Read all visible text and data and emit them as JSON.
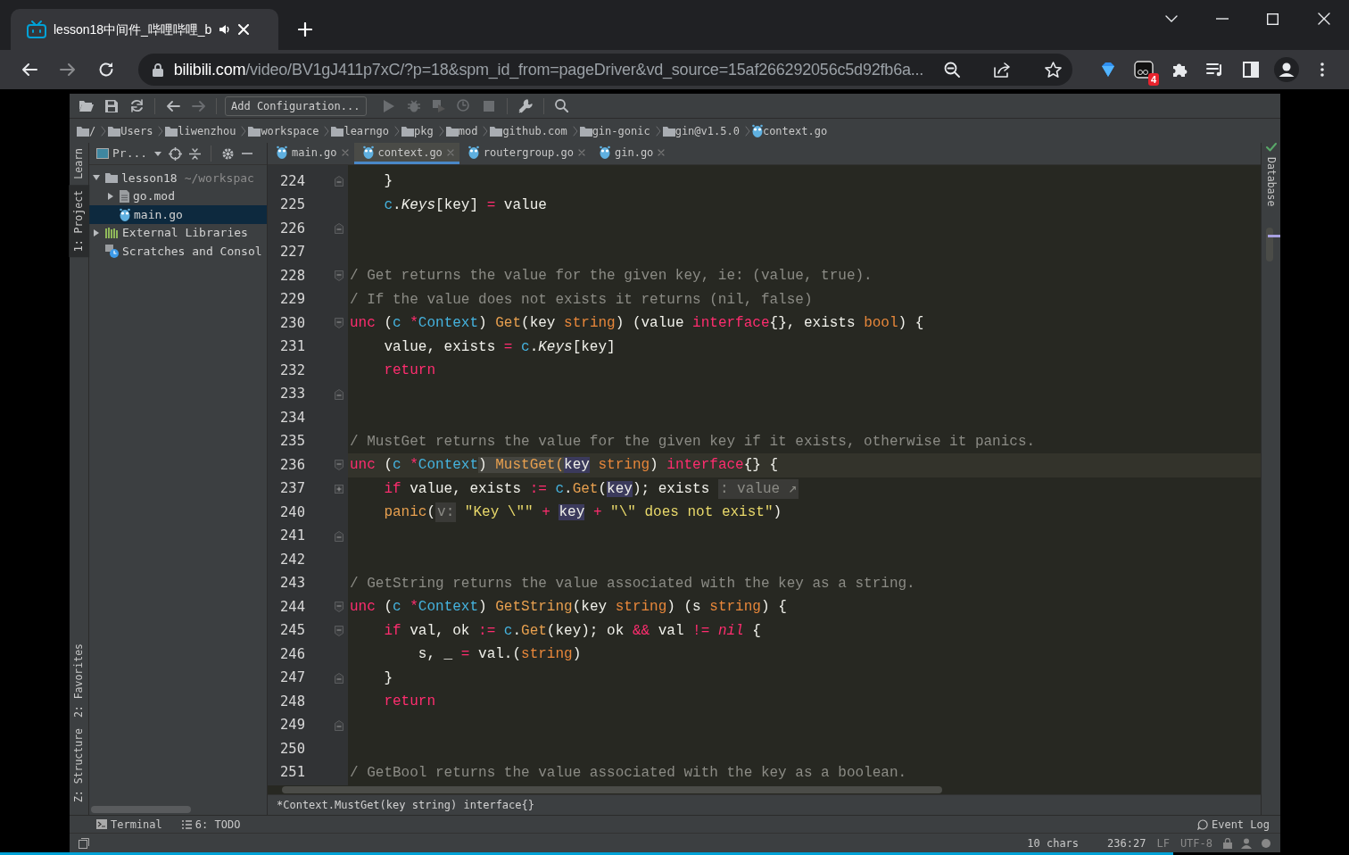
{
  "browser": {
    "tab": {
      "title": "lesson18中间件_哔哩哔哩_b",
      "selected": true
    },
    "address": {
      "host": "bilibili.com",
      "path": "/video/BV1gJ411p7xC/?p=18&spm_id_from=pageDriver&vd_source=15af266292056c5d92fb6a..."
    },
    "extension_badge": "4"
  },
  "ide": {
    "toolbar": {
      "run_config": "Add Configuration..."
    },
    "breadcrumbs": [
      {
        "label": "/",
        "kind": "folder"
      },
      {
        "label": "Users",
        "kind": "folder"
      },
      {
        "label": "liwenzhou",
        "kind": "folder"
      },
      {
        "label": "workspace",
        "kind": "folder"
      },
      {
        "label": "learngo",
        "kind": "folder"
      },
      {
        "label": "pkg",
        "kind": "folder"
      },
      {
        "label": "mod",
        "kind": "folder"
      },
      {
        "label": "github.com",
        "kind": "folder"
      },
      {
        "label": "gin-gonic",
        "kind": "folder"
      },
      {
        "label": "gin@v1.5.0",
        "kind": "folder"
      },
      {
        "label": "context.go",
        "kind": "go"
      }
    ],
    "left_strip": {
      "top": [
        {
          "label": "Learn",
          "selected": false
        },
        {
          "label": "1: Project",
          "selected": true
        }
      ],
      "bottom": [
        {
          "label": "2: Favorites",
          "selected": false
        },
        {
          "label": "Z: Structure",
          "selected": false
        }
      ]
    },
    "project_panel": {
      "title": "Pr...",
      "tree": [
        {
          "label": "lesson18",
          "note": "~/workspac",
          "kind": "folder",
          "expanded": true,
          "selected": false,
          "children": [
            {
              "label": "go.mod",
              "kind": "mod",
              "expanded": false,
              "selected": false
            },
            {
              "label": "main.go",
              "kind": "go",
              "selected": true
            }
          ]
        },
        {
          "label": "External Libraries",
          "kind": "library",
          "expanded": false,
          "selected": false
        },
        {
          "label": "Scratches and Consol",
          "kind": "scratch",
          "selected": false
        }
      ]
    },
    "tabs": [
      {
        "label": "main.go",
        "selected": false
      },
      {
        "label": "context.go",
        "selected": true
      },
      {
        "label": "routergroup.go",
        "selected": false
      },
      {
        "label": "gin.go",
        "selected": false
      }
    ],
    "editor": {
      "lines": [
        {
          "number": "224",
          "current": false,
          "kind": "fold-end",
          "tokens": [
            {
              "kind": "plain",
              "text": "    }"
            }
          ]
        },
        {
          "number": "225",
          "current": false,
          "kind": "plain",
          "tokens": [
            {
              "kind": "recv",
              "text": "    c"
            },
            {
              "kind": "plain",
              "text": "."
            },
            {
              "kind": "field",
              "text": "Keys"
            },
            {
              "kind": "plain",
              "text": "[key] "
            },
            {
              "kind": "op",
              "text": "="
            },
            {
              "kind": "plain",
              "text": " value"
            }
          ]
        },
        {
          "number": "226",
          "current": false,
          "kind": "fold-end"
        },
        {
          "number": "227",
          "current": false,
          "kind": "plain"
        },
        {
          "number": "228",
          "current": false,
          "kind": "fold-start",
          "tokens": [
            {
              "kind": "cmt",
              "text": "/ Get returns the value for the given key, ie: (value, true)."
            }
          ]
        },
        {
          "number": "229",
          "current": false,
          "kind": "plain",
          "tokens": [
            {
              "kind": "cmt",
              "text": "/ If the value does not exists it returns (nil, false)"
            }
          ]
        },
        {
          "number": "230",
          "current": false,
          "kind": "fold-start",
          "tokens": [
            {
              "kind": "kw",
              "text": "unc"
            },
            {
              "kind": "plain",
              "text": " ("
            },
            {
              "kind": "recv",
              "text": "c"
            },
            {
              "kind": "op",
              "text": " *"
            },
            {
              "kind": "recv",
              "text": "Context"
            },
            {
              "kind": "plain",
              "text": ") "
            },
            {
              "kind": "fn",
              "text": "Get"
            },
            {
              "kind": "plain",
              "text": "(key "
            },
            {
              "kind": "type",
              "text": "string"
            },
            {
              "kind": "plain",
              "text": ") (value "
            },
            {
              "kind": "kw",
              "text": "interface"
            },
            {
              "kind": "plain",
              "text": "{}, exists "
            },
            {
              "kind": "type",
              "text": "bool"
            },
            {
              "kind": "plain",
              "text": ") {"
            }
          ]
        },
        {
          "number": "231",
          "current": false,
          "kind": "plain",
          "tokens": [
            {
              "kind": "plain",
              "text": "    value, exists "
            },
            {
              "kind": "op",
              "text": "="
            },
            {
              "kind": "recv",
              "text": " c"
            },
            {
              "kind": "plain",
              "text": "."
            },
            {
              "kind": "field",
              "text": "Keys"
            },
            {
              "kind": "plain",
              "text": "[key]"
            }
          ]
        },
        {
          "number": "232",
          "current": false,
          "kind": "plain",
          "tokens": [
            {
              "kind": "kw",
              "text": "    return"
            }
          ]
        },
        {
          "number": "233",
          "current": false,
          "kind": "fold-end"
        },
        {
          "number": "234",
          "current": false,
          "kind": "plain"
        },
        {
          "number": "235",
          "current": false,
          "kind": "plain",
          "tokens": [
            {
              "kind": "cmt",
              "text": "/ MustGet returns the value for the given key if it exists, otherwise it panics."
            }
          ]
        },
        {
          "number": "236",
          "current": true,
          "kind": "fold-start",
          "tokens": [
            {
              "kind": "kw",
              "text": "unc"
            },
            {
              "kind": "plain",
              "text": " ("
            },
            {
              "kind": "recv",
              "text": "c"
            },
            {
              "kind": "op",
              "text": " *"
            },
            {
              "kind": "recv",
              "text": "Context"
            },
            {
              "kind": "sel-plain",
              "text": ") "
            },
            {
              "kind": "sel-fn",
              "text": "MustGet("
            },
            {
              "kind": "ref",
              "text": "key"
            },
            {
              "kind": "type",
              "text": " string"
            },
            {
              "kind": "plain",
              "text": ") "
            },
            {
              "kind": "kw",
              "text": "interface"
            },
            {
              "kind": "plain",
              "text": "{} {"
            }
          ]
        },
        {
          "number": "237",
          "current": false,
          "kind": "fold-plus",
          "tokens": [
            {
              "kind": "kw",
              "text": "    if"
            },
            {
              "kind": "plain",
              "text": " value, exists "
            },
            {
              "kind": "op",
              "text": ":="
            },
            {
              "kind": "recv",
              "text": " c"
            },
            {
              "kind": "plain",
              "text": "."
            },
            {
              "kind": "fn",
              "text": "Get"
            },
            {
              "kind": "plain",
              "text": "("
            },
            {
              "kind": "ref",
              "text": "key"
            },
            {
              "kind": "plain",
              "text": "); exists "
            },
            {
              "kind": "hint",
              "text": ": value ↗"
            }
          ]
        },
        {
          "number": "240",
          "current": false,
          "kind": "plain",
          "tokens": [
            {
              "kind": "fn",
              "text": "    panic"
            },
            {
              "kind": "plain",
              "text": "("
            },
            {
              "kind": "hint",
              "text": "v:"
            },
            {
              "kind": "str",
              "text": " \"Key \\\"\""
            },
            {
              "kind": "op",
              "text": " + "
            },
            {
              "kind": "ref",
              "text": "key"
            },
            {
              "kind": "op",
              "text": " + "
            },
            {
              "kind": "str",
              "text": "\"\\\" does not exist\""
            },
            {
              "kind": "plain",
              "text": ")"
            }
          ]
        },
        {
          "number": "241",
          "current": false,
          "kind": "fold-end"
        },
        {
          "number": "242",
          "current": false,
          "kind": "plain"
        },
        {
          "number": "243",
          "current": false,
          "kind": "plain",
          "tokens": [
            {
              "kind": "cmt",
              "text": "/ GetString returns the value associated with the key as a string."
            }
          ]
        },
        {
          "number": "244",
          "current": false,
          "kind": "fold-start",
          "tokens": [
            {
              "kind": "kw",
              "text": "unc"
            },
            {
              "kind": "plain",
              "text": " ("
            },
            {
              "kind": "recv",
              "text": "c"
            },
            {
              "kind": "op",
              "text": " *"
            },
            {
              "kind": "recv",
              "text": "Context"
            },
            {
              "kind": "plain",
              "text": ") "
            },
            {
              "kind": "fn",
              "text": "GetString"
            },
            {
              "kind": "plain",
              "text": "(key "
            },
            {
              "kind": "type",
              "text": "string"
            },
            {
              "kind": "plain",
              "text": ") (s "
            },
            {
              "kind": "type",
              "text": "string"
            },
            {
              "kind": "plain",
              "text": ") {"
            }
          ]
        },
        {
          "number": "245",
          "current": false,
          "kind": "fold-start",
          "tokens": [
            {
              "kind": "kw",
              "text": "    if"
            },
            {
              "kind": "plain",
              "text": " val, ok "
            },
            {
              "kind": "op",
              "text": ":="
            },
            {
              "kind": "recv",
              "text": " c"
            },
            {
              "kind": "plain",
              "text": "."
            },
            {
              "kind": "fn",
              "text": "Get"
            },
            {
              "kind": "plain",
              "text": "(key); ok "
            },
            {
              "kind": "op",
              "text": "&&"
            },
            {
              "kind": "plain",
              "text": " val "
            },
            {
              "kind": "op",
              "text": "!="
            },
            {
              "kind": "nil",
              "text": " nil"
            },
            {
              "kind": "plain",
              "text": " {"
            }
          ]
        },
        {
          "number": "246",
          "current": false,
          "kind": "plain",
          "tokens": [
            {
              "kind": "plain",
              "text": "        s, _ "
            },
            {
              "kind": "op",
              "text": "="
            },
            {
              "kind": "plain",
              "text": " val.("
            },
            {
              "kind": "type",
              "text": "string"
            },
            {
              "kind": "plain",
              "text": ")"
            }
          ]
        },
        {
          "number": "247",
          "current": false,
          "kind": "fold-end",
          "tokens": [
            {
              "kind": "plain",
              "text": "    }"
            }
          ]
        },
        {
          "number": "248",
          "current": false,
          "kind": "plain",
          "tokens": [
            {
              "kind": "kw",
              "text": "    return"
            }
          ]
        },
        {
          "number": "249",
          "current": false,
          "kind": "fold-end"
        },
        {
          "number": "250",
          "current": false,
          "kind": "plain"
        },
        {
          "number": "251",
          "current": false,
          "kind": "plain",
          "tokens": [
            {
              "kind": "cmt",
              "text": "/ GetBool returns the value associated with the key as a boolean."
            }
          ]
        }
      ]
    },
    "right_strip": {
      "label": "Database"
    },
    "hint": "*Context.MustGet(key string) interface{}",
    "bottom_tools": [
      {
        "label": "Terminal",
        "kind": "terminal"
      },
      {
        "label": "6: TODO",
        "kind": "todo"
      }
    ],
    "event_log": "Event Log",
    "status": [
      "10 chars",
      "236:27",
      "LF",
      "UTF-8"
    ]
  },
  "video": {
    "progress": {
      "level": 0.87
    }
  }
}
